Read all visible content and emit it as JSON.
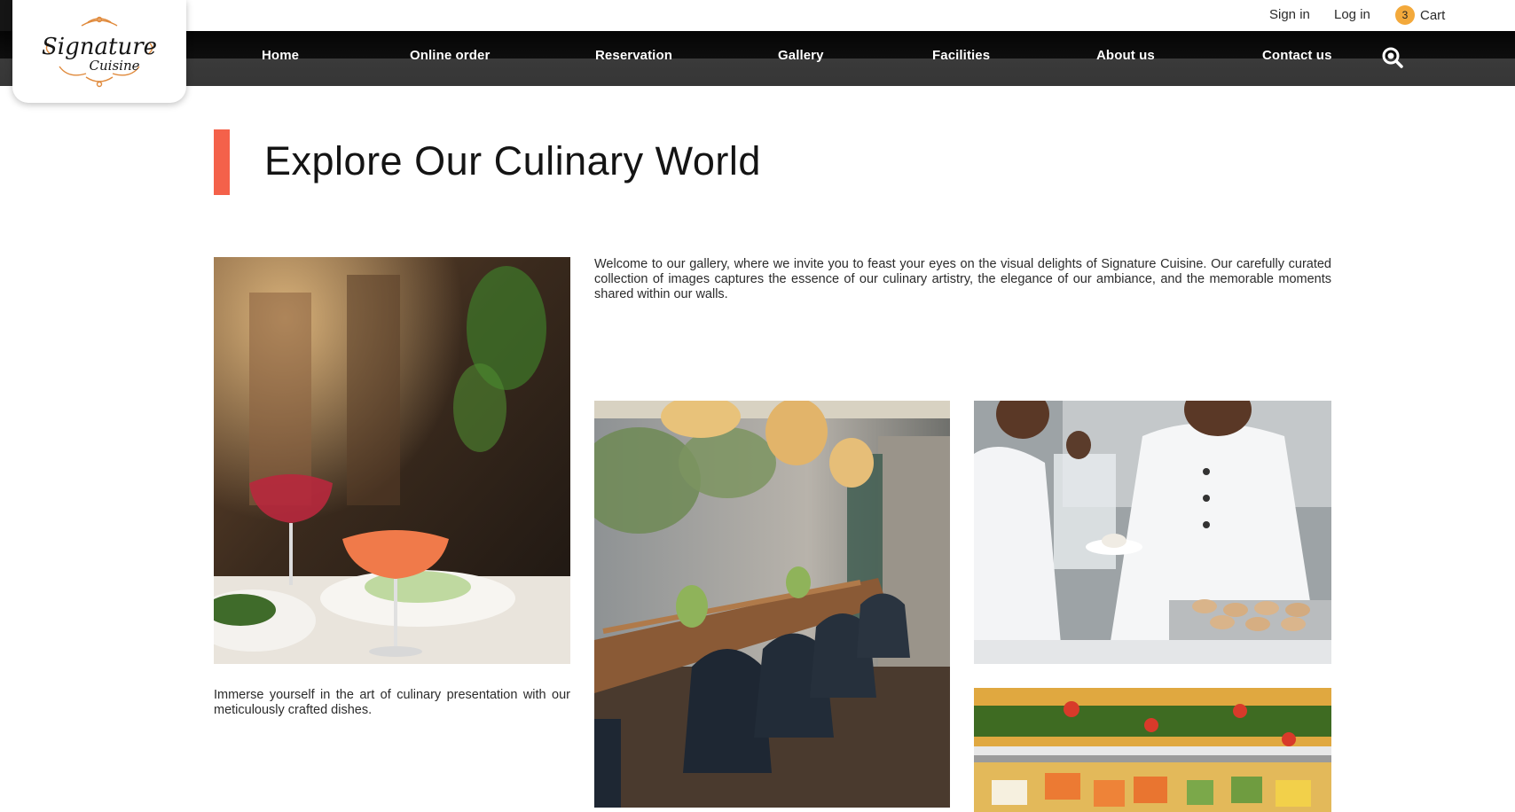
{
  "brand": {
    "logo_line1": "Signature",
    "logo_line2": "Cuisine",
    "accent_color": "#f4614a",
    "badge_color": "#f3a93b"
  },
  "top_links": {
    "sign_in": "Sign in",
    "log_in": "Log in",
    "cart_count": "3",
    "cart_label": "Cart",
    "cart_icon": "cart-badge"
  },
  "nav": {
    "items": [
      {
        "label": "Home"
      },
      {
        "label": "Online order"
      },
      {
        "label": "Reservation"
      },
      {
        "label": "Gallery"
      },
      {
        "label": "Facilities"
      },
      {
        "label": "About us"
      },
      {
        "label": "Contact us"
      }
    ],
    "search_icon": "search-icon"
  },
  "main": {
    "title": "Explore Our Culinary World",
    "intro": "Welcome to our gallery, where we invite you to feast your eyes on the visual delights of Signature Cuisine. Our carefully curated collection of images captures the essence of our culinary artistry, the elegance of our ambiance, and the memorable moments shared within our walls.",
    "caption": "Immerse yourself in the art of culinary presentation with our meticulously crafted dishes."
  },
  "gallery": {
    "images": [
      {
        "subject": "plated-dish-with-cocktail"
      },
      {
        "subject": "restaurant-dining-interior"
      },
      {
        "subject": "chefs-plating-food"
      },
      {
        "subject": "buffet-vegetable-trays"
      }
    ]
  }
}
